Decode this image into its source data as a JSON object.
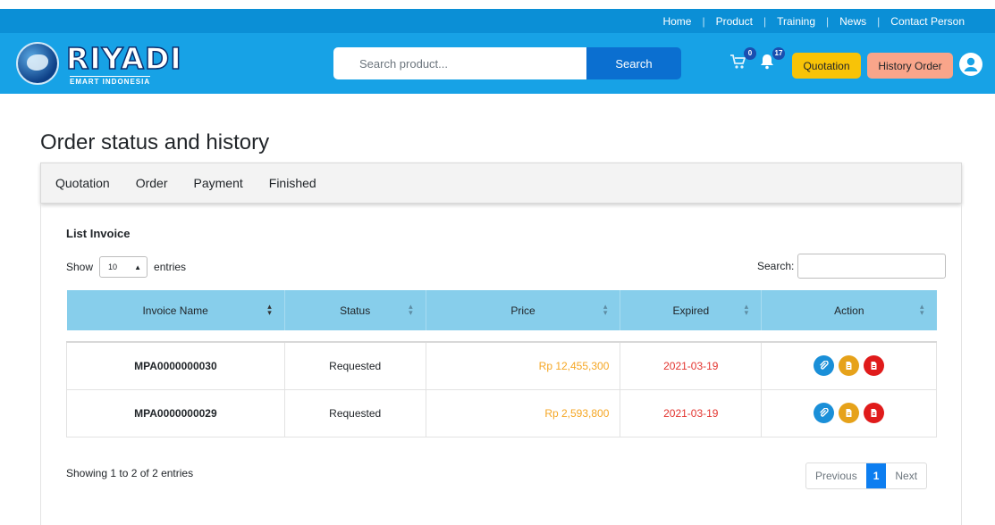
{
  "topnav": {
    "home": "Home",
    "product": "Product",
    "training": "Training",
    "news": "News",
    "contact": "Contact Person",
    "separator": "|"
  },
  "header": {
    "logo_text": "RIYADI",
    "logo_subtext": "EMART INDONESIA",
    "search_placeholder": "Search product...",
    "search_button": "Search",
    "cart_count": "0",
    "notification_count": "17",
    "quotation_button": "Quotation",
    "history_button": "History Order"
  },
  "page": {
    "title": "Order status and history"
  },
  "tabs": [
    "Quotation",
    "Order",
    "Payment",
    "Finished"
  ],
  "list": {
    "title": "List Invoice",
    "show_label": "Show",
    "entries_value": "10",
    "entries_label": "entries",
    "search_label": "Search:",
    "columns": [
      "Invoice Name",
      "Status",
      "Price",
      "Expired",
      "Action"
    ],
    "rows": [
      {
        "invoice": "MPA0000000030",
        "status": "Requested",
        "price": "Rp 12,455,300",
        "expired": "2021-03-19"
      },
      {
        "invoice": "MPA0000000029",
        "status": "Requested",
        "price": "Rp 2,593,800",
        "expired": "2021-03-19"
      }
    ],
    "info": "Showing 1 to 2 of 2 entries",
    "pagination": {
      "previous": "Previous",
      "current": "1",
      "next": "Next"
    }
  },
  "colors": {
    "topbar": "#0b8fd6",
    "header": "#17a2e6",
    "table_header": "#87ceeb",
    "price": "#f5a623",
    "expired": "#e3342f",
    "quotation_btn": "#f8c307",
    "history_btn": "#f9a58a"
  }
}
